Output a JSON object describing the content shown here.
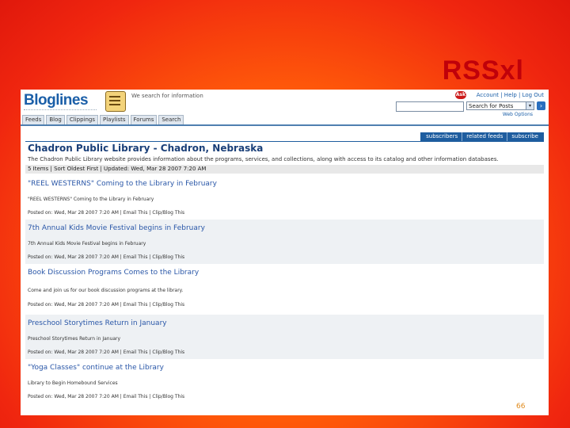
{
  "slide": {
    "title": "RSSxl",
    "page_number": "66"
  },
  "bloglines": {
    "logo": "Bloglines",
    "tagline": "We search for information",
    "account_links": "Account | Help | Log Out",
    "ask_badge": "Ask",
    "search_select_value": "Search for Posts",
    "web_options": "Web Options",
    "nav_tabs": [
      "Feeds",
      "Blog",
      "Clippings",
      "Playlists",
      "Forums",
      "Search"
    ],
    "feed_actions": [
      "subscribers",
      "related feeds",
      "subscribe"
    ],
    "feed": {
      "title": "Chadron Public Library - Chadron, Nebraska",
      "description": "The Chadron Public Library website provides information about the programs, services, and collections, along with access to its catalog and other information databases.",
      "meta": "5 Items | Sort Oldest First | Updated: Wed, Mar 28 2007 7:20 AM"
    },
    "posts": [
      {
        "title": "\"REEL WESTERNS\" Coming to the Library in February",
        "body": "\"REEL WESTERNS\" Coming to the Library in February",
        "meta": "Posted on: Wed, Mar 28 2007 7:20 AM  |  Email This  |  Clip/Blog This"
      },
      {
        "title": "7th Annual Kids Movie Festival begins in February",
        "body": "7th Annual Kids Movie Festival begins in February",
        "meta": "Posted on: Wed, Mar 28 2007 7:20 AM  |  Email This  |  Clip/Blog This"
      },
      {
        "title": "Book Discussion Programs Comes to the Library",
        "body": "Come and join us for our book discussion programs at the library.",
        "meta": "Posted on: Wed, Mar 28 2007 7:20 AM  |  Email This  |  Clip/Blog This"
      },
      {
        "title": "Preschool Storytimes Return in January",
        "body": "Preschool Storytimes Return in January",
        "meta": "Posted on: Wed, Mar 28 2007 7:20 AM  |  Email This  |  Clip/Blog This"
      },
      {
        "title": "\"Yoga Classes\" continue at the Library",
        "body": "Library to Begin Homebound Services",
        "meta": "Posted on: Wed, Mar 28 2007 7:20 AM  |  Email This  |  Clip/Blog This"
      }
    ]
  }
}
